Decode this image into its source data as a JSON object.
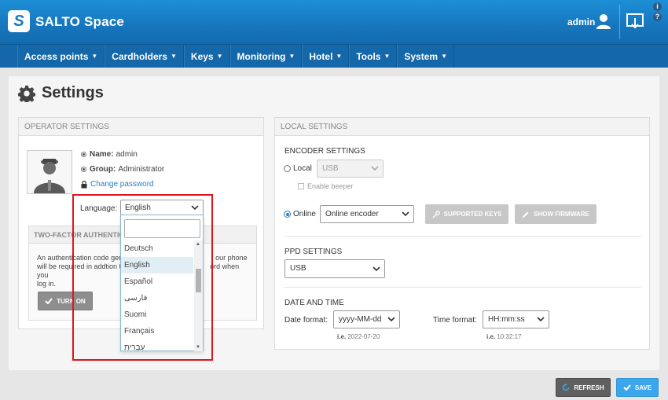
{
  "app": {
    "brand": "SALTO Space",
    "logo_letter": "S",
    "user": "admin"
  },
  "nav": {
    "items": [
      {
        "label": "Access points"
      },
      {
        "label": "Cardholders"
      },
      {
        "label": "Keys"
      },
      {
        "label": "Monitoring"
      },
      {
        "label": "Hotel"
      },
      {
        "label": "Tools"
      },
      {
        "label": "System"
      }
    ]
  },
  "page": {
    "title": "Settings"
  },
  "operator": {
    "heading": "OPERATOR SETTINGS",
    "name_label": "Name:",
    "name_value": "admin",
    "group_label": "Group:",
    "group_value": "Administrator",
    "change_password": "Change password",
    "language_label": "Language:",
    "language_value": "English",
    "tfa": {
      "heading": "TWO-FACTOR AUTHENTICAT",
      "text_line1": "An authentication code gene",
      "text_line1b": "our phone",
      "text_line2": "will be required in addtion t",
      "text_line2b": "ord when you",
      "text_line3": "log in.",
      "button": "TURN ON"
    }
  },
  "language_dropdown": {
    "search_value": "",
    "options": [
      "Deutsch",
      "English",
      "Español",
      "فارسی",
      "Suomi",
      "Français",
      "עִבְרִית"
    ],
    "selected": "English"
  },
  "local": {
    "heading": "LOCAL SETTINGS",
    "encoder": {
      "heading": "ENCODER SETTINGS",
      "local_label": "Local",
      "local_value": "USB",
      "enable_beeper": "Enable beeper",
      "online_label": "Online",
      "online_value": "Online encoder",
      "supported_keys": "SUPPORTED KEYS",
      "show_firmware": "SHOW FIRMWARE"
    },
    "ppd": {
      "heading": "PPD SETTINGS",
      "value": "USB"
    },
    "datetime": {
      "heading": "DATE AND TIME",
      "date_label": "Date format:",
      "date_value": "yyyy-MM-dd",
      "date_hint_label": "i.e.",
      "date_hint": "2022-07-20",
      "time_label": "Time format:",
      "time_value": "HH:mm:ss",
      "time_hint_label": "i.e.",
      "time_hint": "10:32:17"
    }
  },
  "actions": {
    "refresh": "REFRESH",
    "save": "SAVE"
  },
  "colors": {
    "header": "#1676bd",
    "nav": "#1467a8",
    "accent": "#2a7ec0",
    "highlight": "#e0141d",
    "save": "#3ba6ec"
  }
}
